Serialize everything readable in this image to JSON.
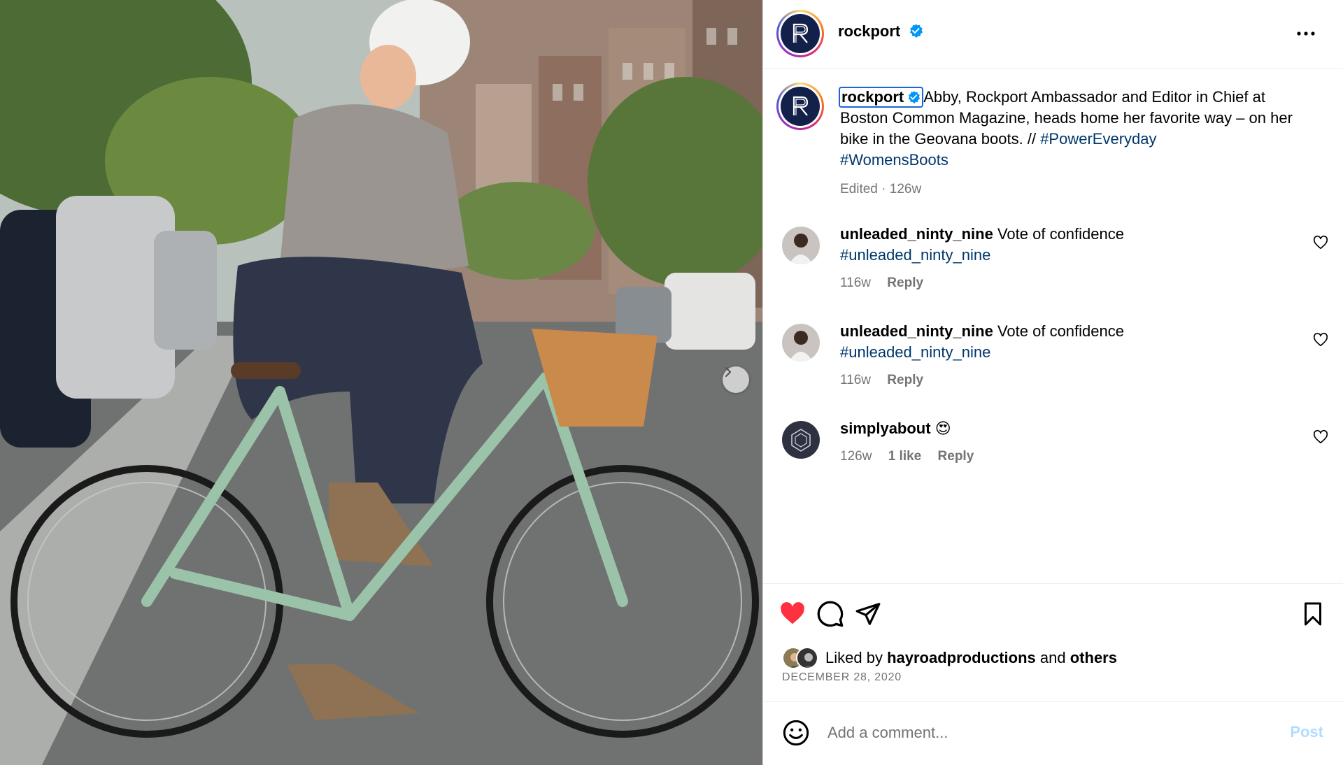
{
  "post": {
    "account": "rockport",
    "caption": {
      "user": "rockport",
      "text": "Abby, Rockport Ambassador and Editor in Chief at Boston Common Magazine, heads home her favorite way – on her bike in the Geovana boots. // ",
      "hashtag1": "#PowerEveryday",
      "hashtag2": "#WomensBoots"
    },
    "meta": "Edited · 126w"
  },
  "comments": [
    {
      "user": "unleaded_ninty_nine",
      "text": "Vote of confidence",
      "tag": "#unleaded_ninty_nine",
      "age": "116w",
      "reply": "Reply"
    },
    {
      "user": "unleaded_ninty_nine",
      "text": "Vote of confidence",
      "tag": "#unleaded_ninty_nine",
      "age": "116w",
      "reply": "Reply"
    },
    {
      "user": "simplyabout",
      "text": "😍",
      "age": "126w",
      "likes": "1 like",
      "reply": "Reply"
    }
  ],
  "likes": {
    "prefix": "Liked by",
    "user": "hayroadproductions",
    "middle": "and",
    "others": "others"
  },
  "date": "DECEMBER 28, 2020",
  "composer": {
    "placeholder": "Add a comment...",
    "post_label": "Post"
  },
  "colors": {
    "like_red": "#ff3040",
    "link_blue": "#00376b",
    "verified_blue": "#0095f6",
    "post_disabled": "#b3dbff"
  },
  "icons": {
    "more": "more-horizontal-icon",
    "like": "heart-filled-icon",
    "comment": "comment-bubble-icon",
    "share": "paper-plane-icon",
    "save": "bookmark-icon",
    "emoji": "smiley-icon",
    "next": "chevron-right-icon"
  }
}
